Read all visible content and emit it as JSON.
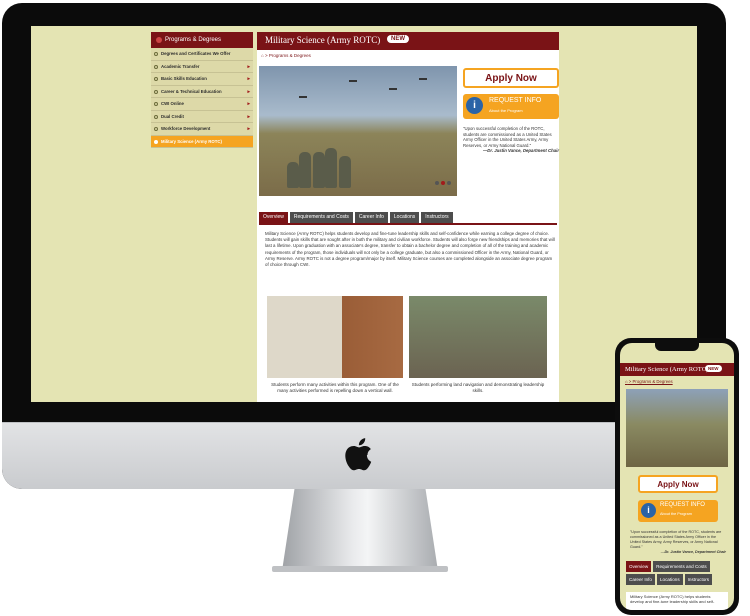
{
  "sidebar": {
    "heading": "Programs & Degrees",
    "items": [
      {
        "label": "Degrees and Certificates We Offer",
        "has_arrow": false,
        "active": false
      },
      {
        "label": "Academic Transfer",
        "has_arrow": true,
        "active": false
      },
      {
        "label": "Basic Skills Education",
        "has_arrow": true,
        "active": false
      },
      {
        "label": "Career & Technical Education",
        "has_arrow": true,
        "active": false
      },
      {
        "label": "CWI Online",
        "has_arrow": true,
        "active": false
      },
      {
        "label": "Dual Credit",
        "has_arrow": true,
        "active": false
      },
      {
        "label": "Workforce Development",
        "has_arrow": true,
        "active": false
      },
      {
        "label": "Military Science (Army ROTC)",
        "has_arrow": false,
        "active": true
      }
    ]
  },
  "page": {
    "title": "Military Science (Army ROTC)",
    "badge": "NEW",
    "breadcrumb": "Programs & Degrees",
    "apply_label": "Apply Now",
    "request": {
      "title": "REQUEST INFO",
      "subtitle": "About the Program"
    },
    "quote": "\"Upon successful completion of the ROTC, students are commissioned as a United States Army Officer in the United States Army, Army Reserves, or Army National Guard.\"",
    "quote_author": "—Dr. Justin Vance, Department Chair",
    "tabs": [
      "Overview",
      "Requirements and Costs",
      "Career Info",
      "Locations",
      "Instructors"
    ],
    "body": "Military Science (Army ROTC) helps students develop and fine-tune leadership skills and self-confidence while earning a college degree of choice. Students will gain skills that are sought after in both the military and civilian workforce. Students will also forge new friendships and memories that will last a lifetime. Upon graduation with an associate's degree, transfer to obtain a bachelor degree and completion of all of the training and academic requirements of the program, those individuals will not only be a college graduate, but also a commissioned Officer in the Army, National Guard, or Army Reserve. Army ROTC is not a degree program/major by itself. Military Science courses are completed alongside an associate degree program of choice through CWI.",
    "caption1": "Students perform many activities within this program. One of the many activities performed is repelling down a vertical wall.",
    "caption2": "Students performing land navigation and demonstrating leadership skills."
  },
  "mobile": {
    "title": "Military Science (Army ROTC)",
    "badge": "NEW",
    "breadcrumb": "Programs & Degrees",
    "apply_label": "Apply Now",
    "request": {
      "title": "REQUEST INFO",
      "subtitle": "About the Program"
    },
    "quote": "\"Upon successful completion of the ROTC, students are commissioned as a United States Army Officer in the United States Army, Army Reserves, or Army National Guard.\"",
    "quote_author": "—Dr. Justin Vance, Department Chair",
    "tabs": [
      "Overview",
      "Requirements and Costs",
      "Career Info",
      "Locations",
      "Instructors"
    ],
    "body": "Military Science (Army ROTC) helps students develop and fine-tune leadership skills and self-"
  },
  "colors": {
    "brand": "#7a1316",
    "accent": "#f5a421",
    "info": "#2a63a6",
    "page_bg": "#e4e4b3"
  }
}
